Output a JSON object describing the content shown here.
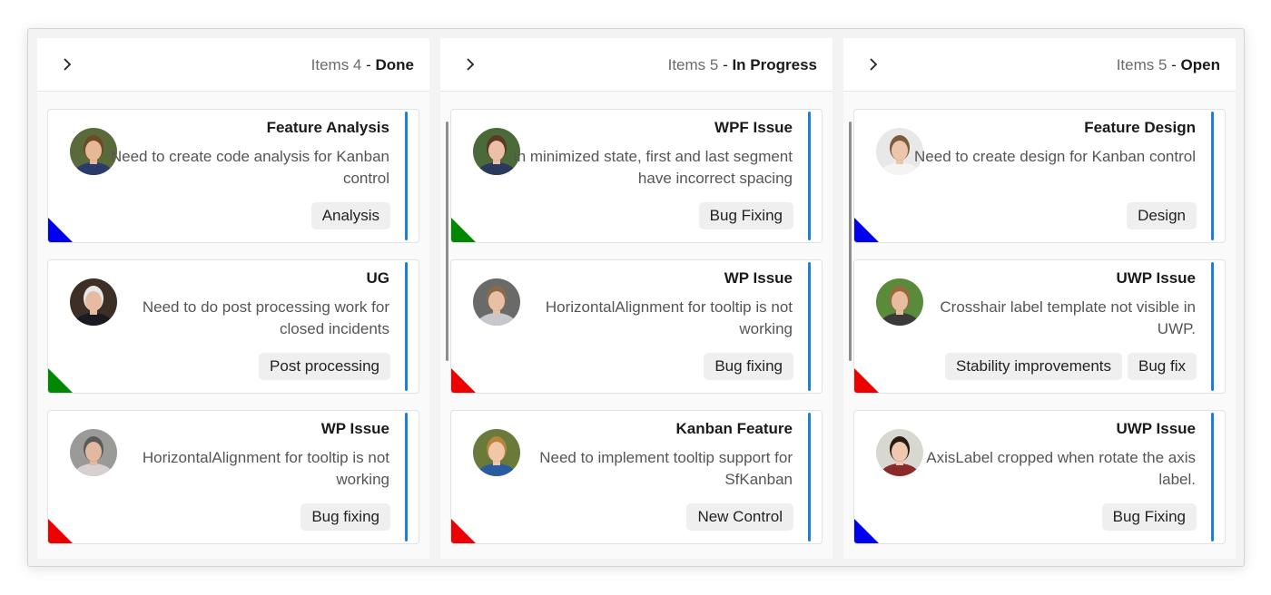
{
  "columns": [
    {
      "count_label": "Items 4",
      "separator": " - ",
      "status": "Done",
      "cards": [
        {
          "title": "Feature Analysis",
          "description": "Need to create code analysis for Kanban control",
          "tags": [
            "Analysis"
          ],
          "priority_color": "#0000ee",
          "avatar": {
            "name": "avatar-man-young",
            "bg": "#5a6a3a",
            "skin": "#e8b894",
            "hair": "#6b4a2a",
            "cloth": "#2a3a6a"
          }
        },
        {
          "title": "UG",
          "description": "Need to do post processing work for closed incidents",
          "tags": [
            "Post processing"
          ],
          "priority_color": "#008800",
          "avatar": {
            "name": "avatar-man-older",
            "bg": "#3d2f25",
            "skin": "#e6bba2",
            "hair": "#e8e8e8",
            "cloth": "#1a1a22"
          }
        },
        {
          "title": "WP Issue",
          "description": "HorizontalAlignment for tooltip is not working",
          "tags": [
            "Bug fixing"
          ],
          "priority_color": "#ee0000",
          "avatar": {
            "name": "avatar-woman-grey",
            "bg": "#9a9a98",
            "skin": "#e2b8a0",
            "hair": "#5c5a58",
            "cloth": "#d8d0d0"
          }
        }
      ]
    },
    {
      "count_label": "Items 5",
      "separator": " - ",
      "status": "In Progress",
      "cards": [
        {
          "title": "WPF Issue",
          "description": "In minimized state, first and last segment have incorrect spacing",
          "tags": [
            "Bug Fixing"
          ],
          "priority_color": "#008800",
          "avatar": {
            "name": "avatar-woman-brunette",
            "bg": "#4a6a3a",
            "skin": "#ecc0a8",
            "hair": "#5a3a22",
            "cloth": "#2a3a5a"
          }
        },
        {
          "title": "WP Issue",
          "description": "HorizontalAlignment for tooltip is not working",
          "tags": [
            "Bug fixing"
          ],
          "priority_color": "#ee0000",
          "avatar": {
            "name": "avatar-woman-smiling",
            "bg": "#6a6a68",
            "skin": "#e8c0a6",
            "hair": "#8a6a4a",
            "cloth": "#c8c8cc"
          }
        },
        {
          "title": "Kanban Feature",
          "description": "Need to implement tooltip support for SfKanban",
          "tags": [
            "New Control"
          ],
          "priority_color": "#ee0000",
          "avatar": {
            "name": "avatar-woman-blonde",
            "bg": "#6a7a3a",
            "skin": "#f0c8a8",
            "hair": "#b8843a",
            "cloth": "#2a5aa0"
          }
        }
      ]
    },
    {
      "count_label": "Items 5",
      "separator": " - ",
      "status": "Open",
      "cards": [
        {
          "title": "Feature Design",
          "description": "Need to create design for Kanban control",
          "tags": [
            "Design"
          ],
          "priority_color": "#0000ee",
          "avatar": {
            "name": "avatar-man-light",
            "bg": "#e8e8e8",
            "skin": "#ecc6aa",
            "hair": "#7a5a3a",
            "cloth": "#f4f4f4"
          }
        },
        {
          "title": "UWP Issue",
          "description": "Crosshair label template not visible in UWP.",
          "tags": [
            "Stability improvements",
            "Bug fix"
          ],
          "priority_color": "#ee0000",
          "avatar": {
            "name": "avatar-woman-outdoor",
            "bg": "#5a8a3a",
            "skin": "#e8bc9c",
            "hair": "#9a6a3a",
            "cloth": "#3a3a3a"
          }
        },
        {
          "title": "UWP Issue",
          "description": "AxisLabel cropped when rotate the axis label.",
          "tags": [
            "Bug Fixing"
          ],
          "priority_color": "#0000ee",
          "avatar": {
            "name": "avatar-woman-dark-hair",
            "bg": "#d8d8d0",
            "skin": "#f0c8b0",
            "hair": "#2a1a14",
            "cloth": "#8a2a2a"
          }
        }
      ]
    }
  ]
}
